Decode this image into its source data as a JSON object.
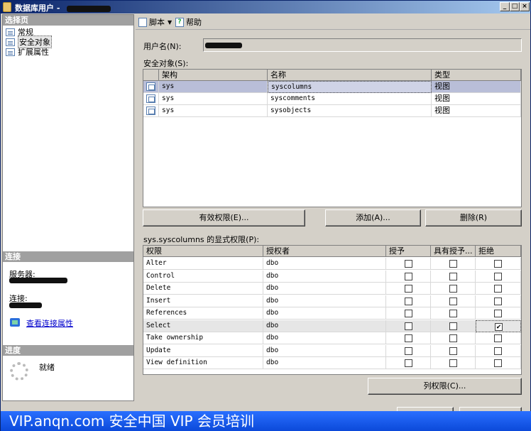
{
  "window": {
    "title": "数据库用户 - ",
    "controls": {
      "minimize": "_",
      "maximize": "□",
      "close": "×"
    }
  },
  "left": {
    "select_page_header": "选择页",
    "nav_items": [
      {
        "label": "常规",
        "icon": "page-icon"
      },
      {
        "label": "安全对象",
        "icon": "page-icon",
        "selected": true
      },
      {
        "label": "扩展属性",
        "icon": "page-icon"
      }
    ],
    "connection_header": "连接",
    "server_label": "服务器:",
    "connection_label": "连接:",
    "view_props_link": "查看连接属性",
    "progress_header": "进度",
    "status": "就绪"
  },
  "toolbar": {
    "script_label": "脚本",
    "help_label": "帮助"
  },
  "user_name_label": "用户名(N):",
  "securables_label": "安全对象(S):",
  "securables": {
    "columns": [
      "架构",
      "名称",
      "类型"
    ],
    "rows": [
      {
        "schema": "sys",
        "name": "syscolumns",
        "type": "视图",
        "selected": true
      },
      {
        "schema": "sys",
        "name": "syscomments",
        "type": "视图"
      },
      {
        "schema": "sys",
        "name": "sysobjects",
        "type": "视图"
      }
    ]
  },
  "buttons": {
    "effective_permissions": "有效权限(E)...",
    "add": "添加(A)...",
    "remove": "删除(R)",
    "column_permissions": "列权限(C)..."
  },
  "explicit_permissions_label": "sys.syscolumns 的显式权限(P):",
  "permissions": {
    "columns": [
      "权限",
      "授权者",
      "授予",
      "具有授予...",
      "拒绝"
    ],
    "rows": [
      {
        "permission": "Alter",
        "grantor": "dbo",
        "grant": false,
        "with_grant": false,
        "deny": false
      },
      {
        "permission": "Control",
        "grantor": "dbo",
        "grant": false,
        "with_grant": false,
        "deny": false
      },
      {
        "permission": "Delete",
        "grantor": "dbo",
        "grant": false,
        "with_grant": false,
        "deny": false
      },
      {
        "permission": "Insert",
        "grantor": "dbo",
        "grant": false,
        "with_grant": false,
        "deny": false
      },
      {
        "permission": "References",
        "grantor": "dbo",
        "grant": false,
        "with_grant": false,
        "deny": false
      },
      {
        "permission": "Select",
        "grantor": "dbo",
        "grant": false,
        "with_grant": false,
        "deny": true,
        "selected": true
      },
      {
        "permission": "Take ownership",
        "grantor": "dbo",
        "grant": false,
        "with_grant": false,
        "deny": false
      },
      {
        "permission": "Update",
        "grantor": "dbo",
        "grant": false,
        "with_grant": false,
        "deny": false
      },
      {
        "permission": "View definition",
        "grantor": "dbo",
        "grant": false,
        "with_grant": false,
        "deny": false
      }
    ]
  },
  "banner": "VIP.anqn.com  安全中国 VIP 会员培训"
}
